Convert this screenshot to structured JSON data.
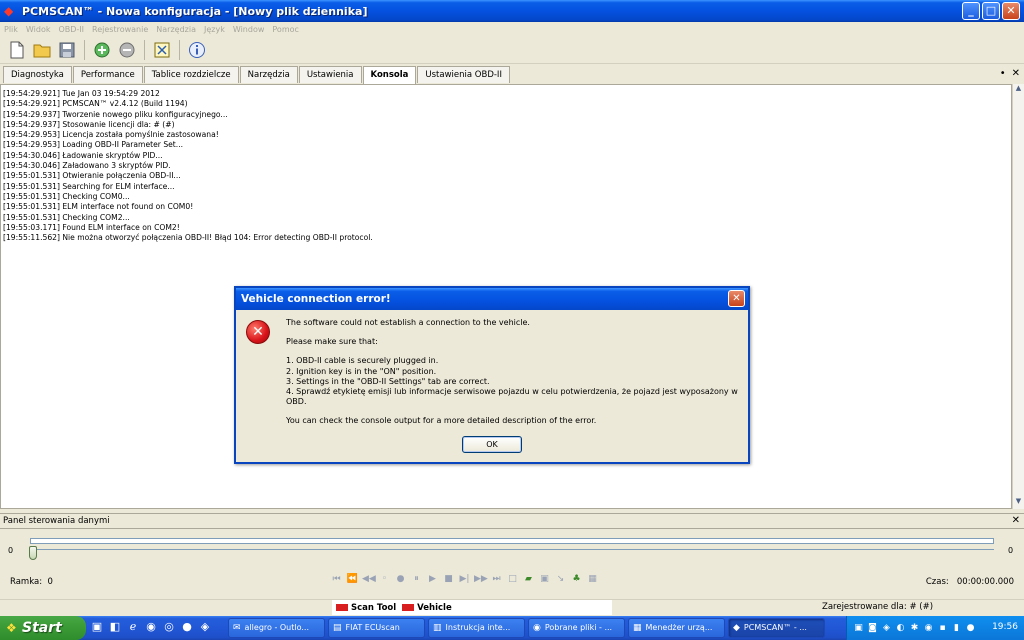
{
  "window": {
    "title": "PCMSCAN™ - Nowa konfiguracja - [Nowy plik dziennika]",
    "min": "_",
    "max": "□",
    "close": "✕"
  },
  "menu": [
    "Plik",
    "Widok",
    "OBD-II",
    "Rejestrowanie",
    "Narzędzia",
    "Język",
    "Window",
    "Pomoc"
  ],
  "tabs": [
    {
      "label": "Diagnostyka"
    },
    {
      "label": "Performance"
    },
    {
      "label": "Tablice rozdzielcze"
    },
    {
      "label": "Narzędzia"
    },
    {
      "label": "Ustawienia"
    },
    {
      "label": "Konsola",
      "active": true
    },
    {
      "label": "Ustawienia OBD-II"
    }
  ],
  "tab_tools": {
    "pin": "•",
    "close": "✕"
  },
  "console": [
    "[19:54:29.921] Tue Jan 03 19:54:29 2012",
    "[19:54:29.921] PCMSCAN™ v2.4.12 (Build 1194)",
    "[19:54:29.937] Tworzenie nowego pliku konfiguracyjnego...",
    "[19:54:29.937] Stosowanie licencji dla: # (#)",
    "[19:54:29.953] Licencja została pomyślnie zastosowana!",
    "[19:54:29.953] Loading OBD-II Parameter Set...",
    "[19:54:30.046] Ładowanie skryptów PID...",
    "[19:54:30.046] Załadowano 3 skryptów PID.",
    "[19:55:01.531] Otwieranie połączenia OBD-II...",
    "[19:55:01.531] Searching for ELM interface...",
    "[19:55:01.531] Checking COM0...",
    "[19:55:01.531] ELM interface not found on COM0!",
    "[19:55:01.531] Checking COM2...",
    "[19:55:03.171] Found ELM interface on COM2!",
    "[19:55:11.562] Nie można otworzyć połączenia OBD-II! Błąd 104: Error detecting OBD-II protocol."
  ],
  "dialog": {
    "title": "Vehicle connection error!",
    "close": "✕",
    "icon": "✕",
    "message": "The software could not establish a connection to the vehicle.",
    "make_sure": "Please make sure that:",
    "items": [
      "1. OBD-II cable is securely plugged in.",
      "2. Ignition key is in the \"ON\" position.",
      "3. Settings in the \"OBD-II Settings\" tab are correct.",
      "4. Sprawdź etykietę emisji lub informacje serwisowe pojazdu w celu potwierdzenia, że pojazd jest wyposażony w OBD."
    ],
    "footer": "You can check the console output for a more detailed description of the error.",
    "ok": "OK"
  },
  "panel": {
    "title": "Panel sterowania danymi",
    "close": "✕",
    "slider_min": "0",
    "slider_max": "0",
    "ramka_label": "Ramka:",
    "ramka_value": "0",
    "czas_label": "Czas:",
    "czas_value": "00:00:00.000"
  },
  "status": {
    "tab1": "Scan Tool",
    "tab2": "Vehicle",
    "registered": "Zarejestrowane dla: # (#)"
  },
  "taskbar": {
    "start": "Start",
    "tasks": [
      {
        "label": "allegro - Outlo..."
      },
      {
        "label": "FIAT ECUscan"
      },
      {
        "label": "Instrukcja inte..."
      },
      {
        "label": "Pobrane pliki - ..."
      },
      {
        "label": "Menedżer urzą..."
      },
      {
        "label": "PCMSCAN™ - ...",
        "active": true
      }
    ],
    "clock": "19:56"
  }
}
